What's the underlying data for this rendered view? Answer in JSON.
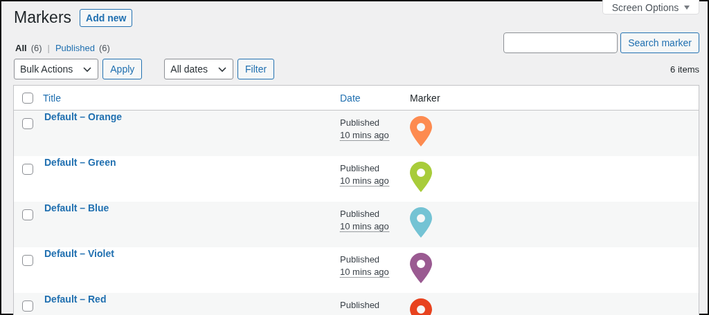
{
  "page": {
    "title": "Markers",
    "add_new": "Add new",
    "screen_options": "Screen Options"
  },
  "views": [
    {
      "label": "All",
      "count": "(6)",
      "selected": true
    },
    {
      "label": "Published",
      "count": "(6)",
      "selected": false
    }
  ],
  "views_separator": "|",
  "search": {
    "button": "Search marker"
  },
  "bulk_actions": {
    "value": "Bulk Actions",
    "apply": "Apply"
  },
  "date_filter": {
    "value": "All dates",
    "button": "Filter"
  },
  "items_count": "6 items",
  "table": {
    "columns": [
      {
        "label": "Title",
        "sortable": true
      },
      {
        "label": "Date",
        "sortable": true
      },
      {
        "label": "Marker",
        "sortable": false
      }
    ],
    "rows": [
      {
        "title": "Default – Orange",
        "status": "Published",
        "date": "10 mins ago",
        "color": "#fd8b50",
        "checked": false
      },
      {
        "title": "Default – Green",
        "status": "Published",
        "date": "10 mins ago",
        "color": "#a8cc3a",
        "checked": false
      },
      {
        "title": "Default – Blue",
        "status": "Published",
        "date": "10 mins ago",
        "color": "#74c3d4",
        "checked": false
      },
      {
        "title": "Default – Violet",
        "status": "Published",
        "date": "10 mins ago",
        "color": "#9a5a91",
        "checked": false
      },
      {
        "title": "Default – Red",
        "status": "Published",
        "color": "#e8431f",
        "checked": false
      }
    ],
    "select_all_checked": false
  }
}
